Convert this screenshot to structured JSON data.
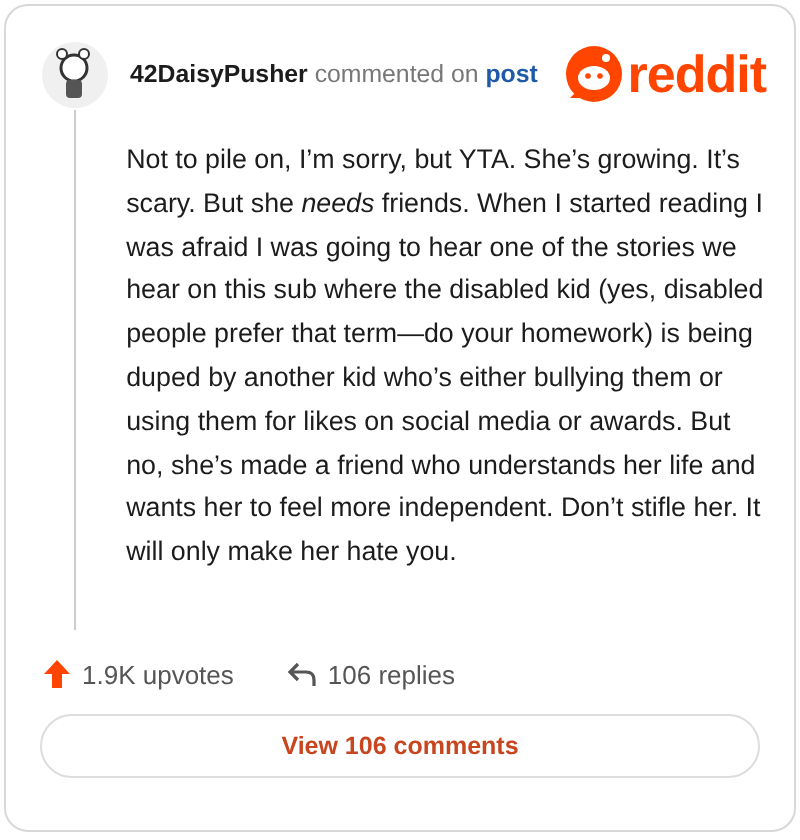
{
  "comment": {
    "author": "42DaisyPusher",
    "action": "commented on",
    "link": "post",
    "body": "Not to pile on, I’m sorry, but YTA. She’s growing. It’s scary. But she *needs* friends. When I started reading I was afraid I was going to hear one of the stories we hear on this sub where the disabled kid (yes, disabled people prefer that term—do your homework) is being duped by another kid who’s either bullying them or using them for likes on social media or awards. But no, she’s made a friend who understands her life and wants her to feel more independent. Don’t stifle her. It will only make her hate you.",
    "upvotes": "1.9K upvotes",
    "replies": "106 replies"
  },
  "brand": {
    "wordmark": "reddit"
  },
  "button": "View 106 comments"
}
